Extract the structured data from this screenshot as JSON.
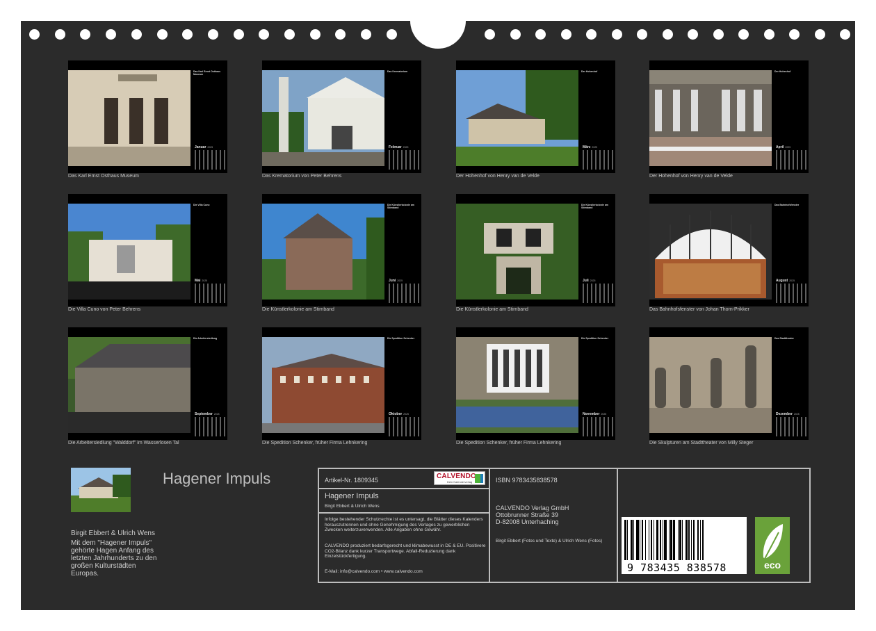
{
  "months": [
    {
      "name": "Januar",
      "year": "2025",
      "caption": "Das Karl Ernst Osthaus Museum",
      "heading": "Das Karl Ernst Osthaus Museum",
      "scene": "museum"
    },
    {
      "name": "Februar",
      "year": "2025",
      "caption": "Das Krematorium von Peter Behrens",
      "heading": "Das Krematorium",
      "scene": "krematorium"
    },
    {
      "name": "März",
      "year": "2025",
      "caption": "Der Hohenhof von Henry van de Velde",
      "heading": "Der Hohenhof",
      "scene": "hohenhof1"
    },
    {
      "name": "April",
      "year": "2025",
      "caption": "Der Hohenhof von Henry van de Velde",
      "heading": "Der Hohenhof",
      "scene": "hohenhof2"
    },
    {
      "name": "Mai",
      "year": "2025",
      "caption": "Die Villa Cuno von Peter Behrens",
      "heading": "Die Villa Cuno",
      "scene": "villa"
    },
    {
      "name": "Juni",
      "year": "2025",
      "caption": "Die Künstlerkolonie am Stirnband",
      "heading": "Die Künstlerkolonie am Stirnband",
      "scene": "kolonie1"
    },
    {
      "name": "Juli",
      "year": "2025",
      "caption": "Die Künstlerkolonie am Stirnband",
      "heading": "Die Künstlerkolonie am Stirnband",
      "scene": "kolonie2"
    },
    {
      "name": "August",
      "year": "2025",
      "caption": "Das Bahnhofsfenster von Johan Thorn-Prikker",
      "heading": "Das Bahnhofsfenster",
      "scene": "fenster"
    },
    {
      "name": "September",
      "year": "2025",
      "caption": "Die Arbeitersiedlung \"Walddorf\" im Wasserlosen Tal",
      "heading": "Die Arbeitersiedlung",
      "scene": "siedlung"
    },
    {
      "name": "Oktober",
      "year": "2025",
      "caption": "Die Spedition Schenker, früher Firma Lehnkering",
      "heading": "Die Spedition Schenker",
      "scene": "spedition1"
    },
    {
      "name": "November",
      "year": "2025",
      "caption": "Die Spedition Schenker, früher Firma Lehnkering",
      "heading": "Die Spedition Schenker",
      "scene": "spedition2"
    },
    {
      "name": "Dezember",
      "year": "2025",
      "caption": "Die Skulpturen am Stadttheater von Milly Steger",
      "heading": "Das Stadttheater",
      "scene": "theater"
    }
  ],
  "footer": {
    "title": "Hagener Impuls",
    "authors": "Birgit Ebbert & Ulrich Wens",
    "description": "Mit dem \"Hagener Impuls\" gehörte Hagen Anfang des letzten Jahrhunderts zu den großen Kulturstädten Europas.",
    "article_no": "Artikel-Nr. 1809345",
    "calvendo_logo": "CALVENDO",
    "calvendo_sub": "Dein Kalenderverlag",
    "box_title": "Hagener Impuls",
    "box_authors": "Birgit Ebbert & Ulrich Wens",
    "legal_1": "Infolge bestehender Schutzrechte ist es untersagt, die Blätter dieses Kalenders herauszutrennen und ohne Genehmigung des Verlages zu gewerblichen Zwecken weiterzuverwenden. Alle Angaben ohne Gewähr.",
    "legal_2": "CALVENDO produziert bedarfsgerecht und klimabewusst in DE & EU. Positivere CO2-Bilanz dank kurzer Transportwege. Abfall-Reduzierung dank Einzelstückfertigung.",
    "contact": "E-Mail: info@calvendo.com • www.calvendo.com",
    "isbn": "ISBN 9783435838578",
    "publisher_name": "CALVENDO Verlag GmbH",
    "publisher_street": "Ottobrunner Straße 39",
    "publisher_city": "D-82008 Unterhaching",
    "credits": "Birgit Ebbert (Fotos und Texte) & Ulrich Wens (Fotos)",
    "barcode_text": "9 783435 838578",
    "eco_label": "eco"
  }
}
